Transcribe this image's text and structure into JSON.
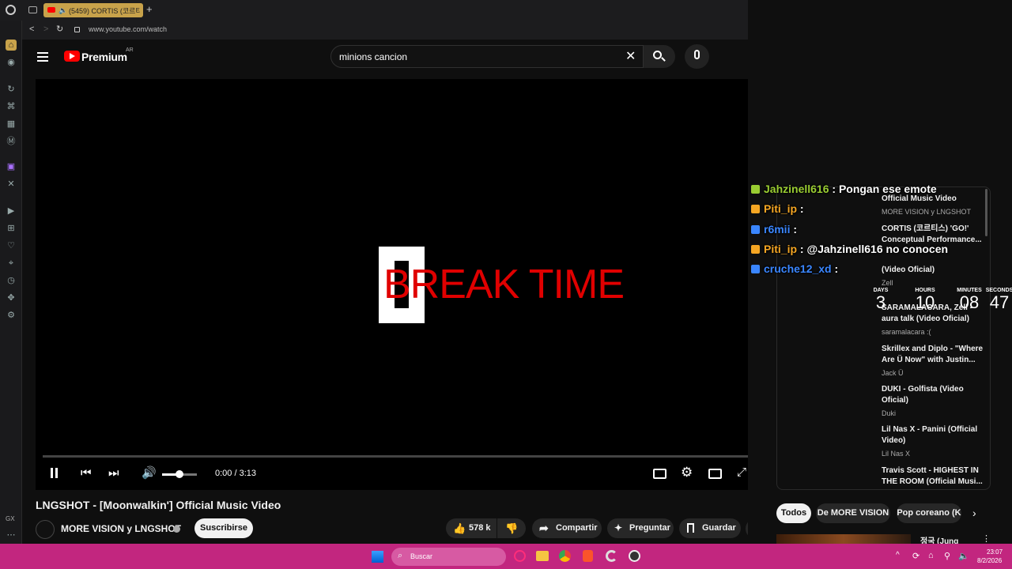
{
  "browser": {
    "tab_title": "(5459) CORTIS (코르티",
    "url": "www.youtube.com/watch",
    "sidebar_bottom_label": "GX"
  },
  "header": {
    "logo_text": "Premium",
    "logo_sup": "AR",
    "search_value": "minions cancion"
  },
  "player": {
    "overlay_text": "BREAK TIME",
    "time": "0:00 / 3:13",
    "progress": 0,
    "volume": 0.5
  },
  "video_info": {
    "title": "LNGSHOT - [Moonwalkin'] Official Music Video",
    "channel": "MORE VISION y LNGSHOT",
    "subscribe_label": "Suscribirse",
    "likes": "578 k",
    "share_label": "Compartir",
    "ask_label": "Preguntar",
    "save_label": "Guardar"
  },
  "chat": [
    {
      "user": "Jahzinell616",
      "message": ": Pongan ese emote",
      "color": "#9acd32"
    },
    {
      "user": "Piti_ip",
      "message": ":",
      "color": "#f5a623"
    },
    {
      "user": "r6mii",
      "message": ":",
      "color": "#3a86ff"
    },
    {
      "user": "Piti_ip",
      "message": ": @Jahzinell616 no conocen",
      "color": "#f5a623"
    },
    {
      "user": "cruche12_xd",
      "message": ":",
      "color": "#3a86ff"
    }
  ],
  "countdown": {
    "labels": [
      "DAYS",
      "HOURS",
      "MINUTES",
      "SECONDS"
    ],
    "values": [
      "3",
      "10",
      "08",
      "47"
    ]
  },
  "recommendations": [
    {
      "title": "Official Music Video",
      "channel": "MORE VISION y LNGSHOT"
    },
    {
      "title": "CORTIS (코르티스) 'GO!' Conceptual Performance...",
      "channel": ""
    },
    {
      "title": "(Video Oficial)",
      "channel": "Zell"
    },
    {
      "title": "SARAMALACARA, Zell - aura talk (Video Oficial)",
      "channel": "saramalacara :("
    },
    {
      "title": "Skrillex and Diplo - \"Where Are Ü Now\" with Justin...",
      "channel": "Jack Ü"
    },
    {
      "title": "DUKI - Golfista (Video Oficial)",
      "channel": "Duki"
    },
    {
      "title": "Lil Nas X - Panini (Official Video)",
      "channel": "Lil Nas X"
    },
    {
      "title": "Travis Scott - HIGHEST IN THE ROOM (Official Musi...",
      "channel": ""
    }
  ],
  "chips": [
    "Todos",
    "De MORE VISION",
    "Pop coreano (K"
  ],
  "bottom_rec_title": "정국 (Jung",
  "taskbar": {
    "search_placeholder": "Buscar",
    "time": "23:07",
    "date": "8/2/2026"
  }
}
